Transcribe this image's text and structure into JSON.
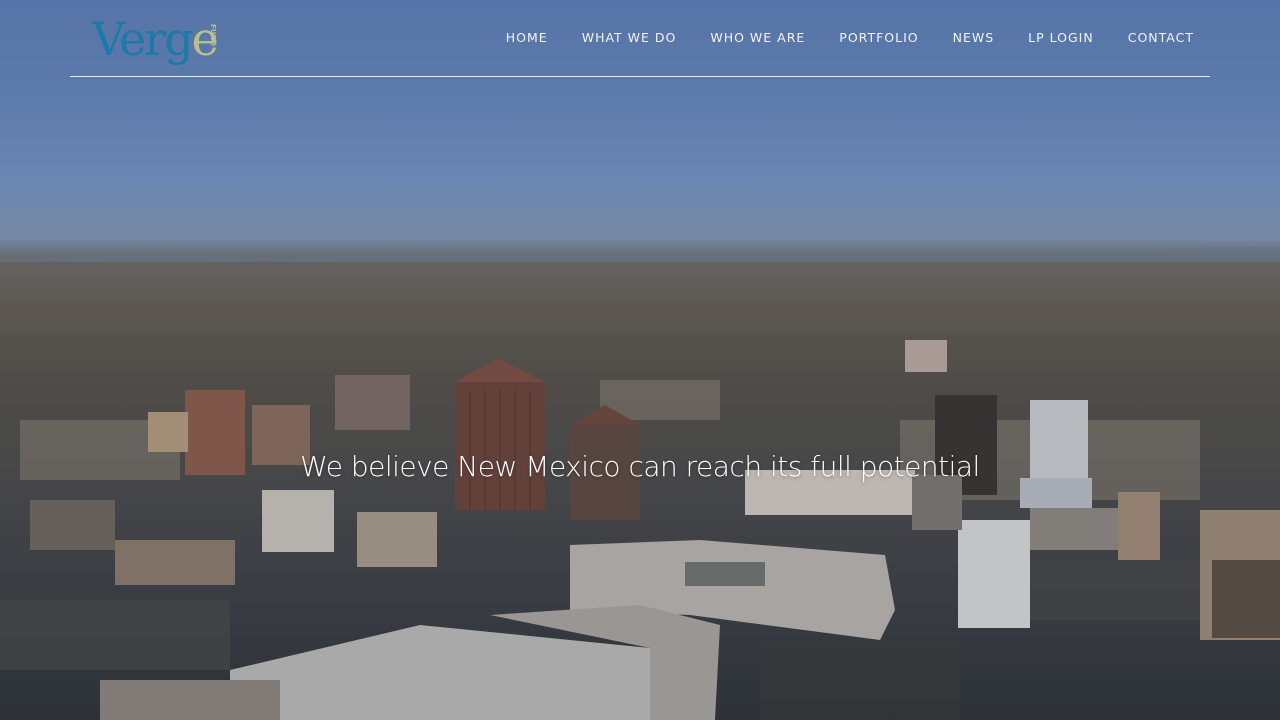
{
  "brand": {
    "logo_text_main": "Verg",
    "logo_text_accent": "e",
    "logo_text_sub": "FUND"
  },
  "nav": {
    "items": [
      {
        "label": "HOME"
      },
      {
        "label": "WHAT WE DO"
      },
      {
        "label": "WHO WE ARE"
      },
      {
        "label": "PORTFOLIO"
      },
      {
        "label": "NEWS"
      },
      {
        "label": "LP LOGIN"
      },
      {
        "label": "CONTACT"
      }
    ]
  },
  "hero": {
    "tagline": "We believe New Mexico can reach its full potential"
  },
  "colors": {
    "logo_blue": "#1b7aa8",
    "logo_accent": "#b9c08a",
    "nav_text": "#f2f4f8"
  }
}
